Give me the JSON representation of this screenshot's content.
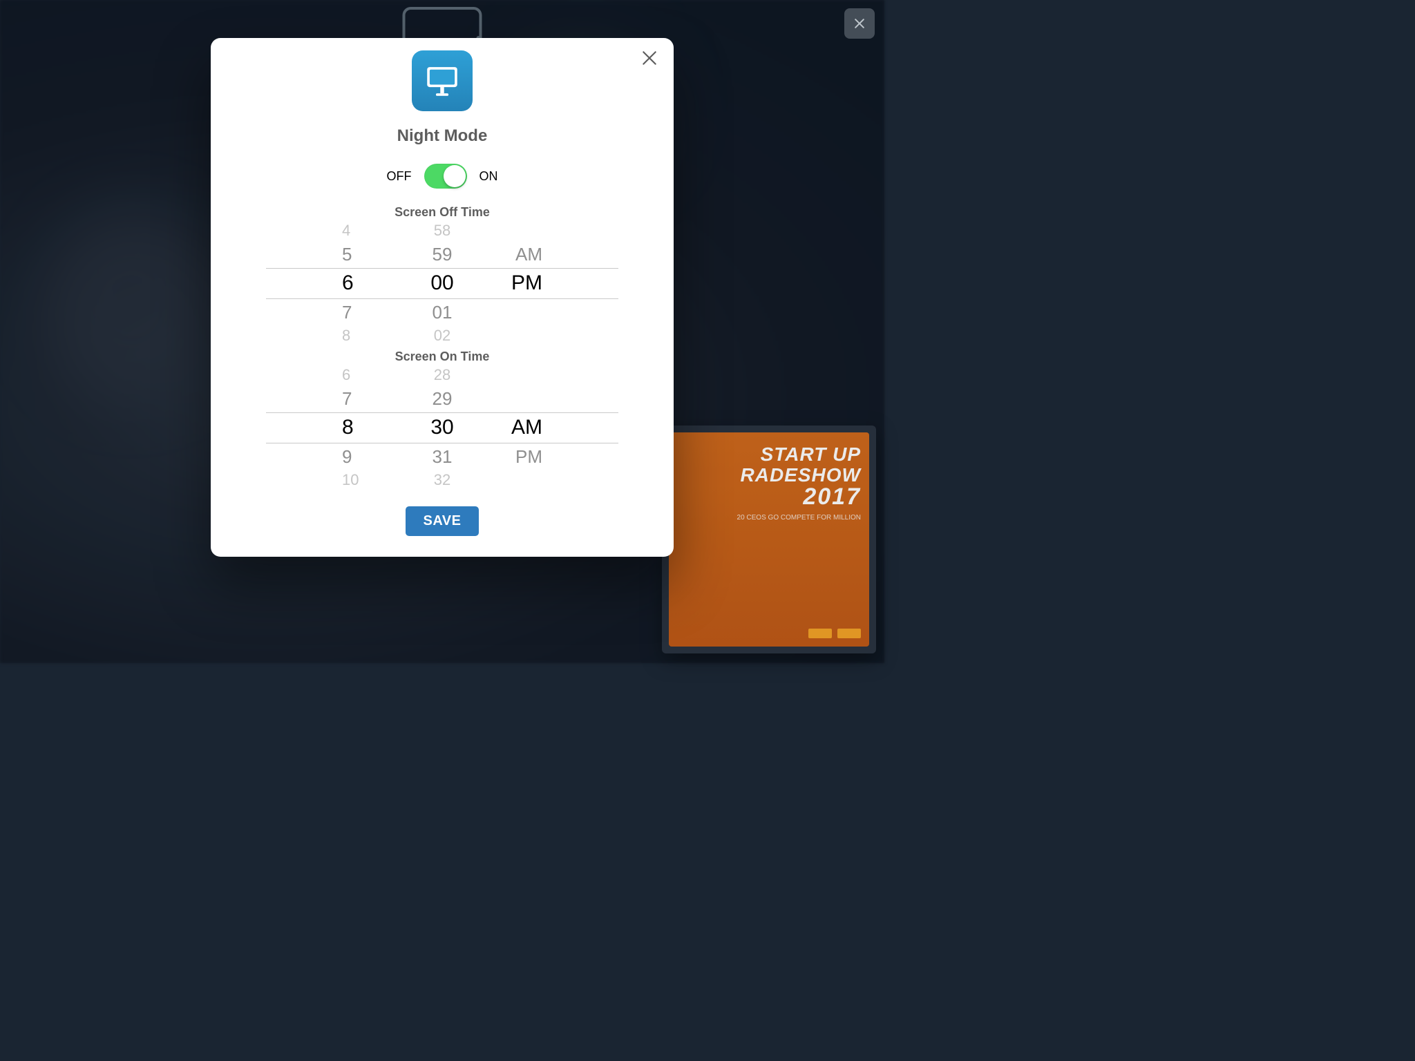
{
  "backdrop": {
    "close_visible": true,
    "bg_card": {
      "line1": "START UP",
      "line2": "RADESHOW",
      "line3": "2017",
      "subline": "20 CEOS GO COMPETE FOR MILLION"
    }
  },
  "modal": {
    "title": "Night Mode",
    "toggle": {
      "off_label": "OFF",
      "on_label": "ON",
      "state": "on"
    },
    "save_label": "SAVE",
    "pickers": {
      "off_time": {
        "label": "Screen Off Time",
        "hours_visible": [
          "4",
          "5",
          "6",
          "7",
          "8"
        ],
        "minutes_visible": [
          "58",
          "59",
          "00",
          "01",
          "02"
        ],
        "ampm_visible": [
          "",
          "AM",
          "PM",
          "",
          ""
        ],
        "selected_index": 2,
        "selected": {
          "hour": "6",
          "minute": "00",
          "ampm": "PM"
        }
      },
      "on_time": {
        "label": "Screen On Time",
        "hours_visible": [
          "6",
          "7",
          "8",
          "9",
          "10"
        ],
        "minutes_visible": [
          "28",
          "29",
          "30",
          "31",
          "32"
        ],
        "ampm_visible": [
          "",
          "",
          "AM",
          "PM",
          ""
        ],
        "selected_index": 2,
        "selected": {
          "hour": "8",
          "minute": "30",
          "ampm": "AM"
        }
      }
    }
  },
  "colors": {
    "accent_blue": "#2e7bbd",
    "toggle_green": "#4cd964",
    "icon_blue": "#2ea0d6"
  }
}
